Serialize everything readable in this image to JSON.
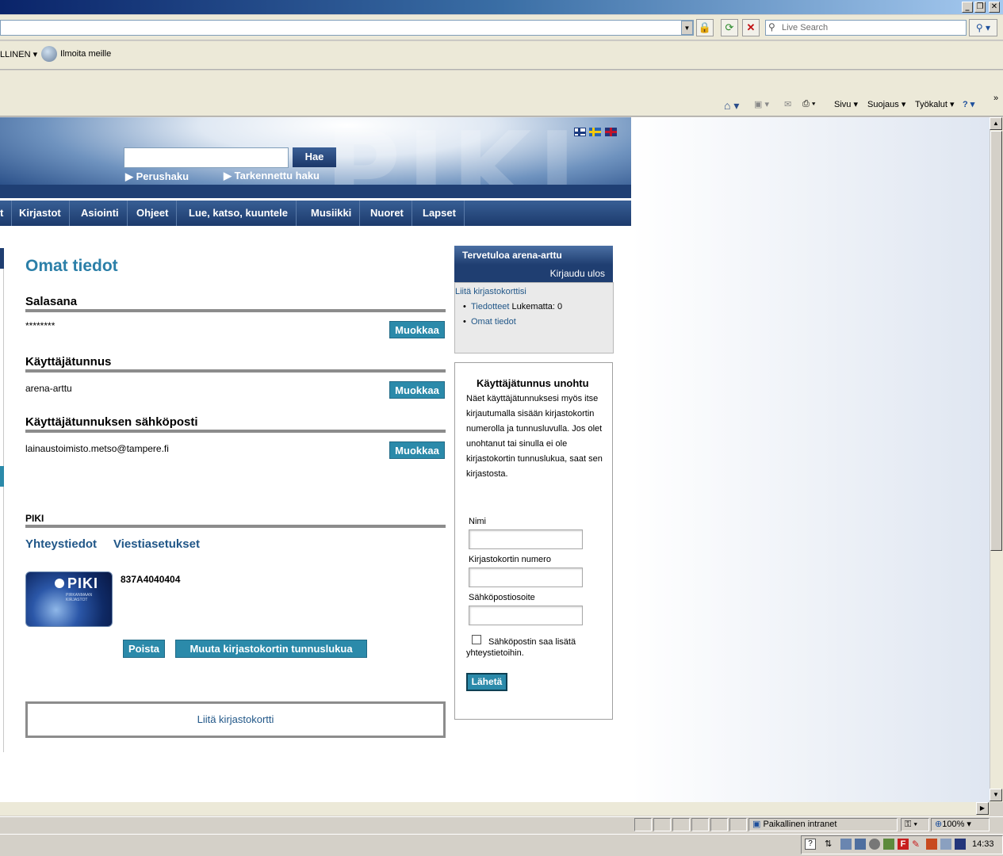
{
  "browser": {
    "live_search_placeholder": "Live Search",
    "links_item": "LLINEN",
    "links_report": "Ilmoita meille",
    "cmd_page": "Sivu",
    "cmd_safety": "Suojaus",
    "cmd_tools": "Työkalut",
    "status_zone": "Paikallinen intranet",
    "zoom": "100%",
    "clock": "14:33"
  },
  "header": {
    "search_button": "Hae",
    "basic_search": "Perushaku",
    "advanced_search": "Tarkennettu haku",
    "banner_logo": "PIKI"
  },
  "nav": {
    "items": [
      "t",
      "Kirjastot",
      "Asiointi",
      "Ohjeet",
      "Lue, katso, kuuntele",
      "Musiikki",
      "Nuoret",
      "Lapset"
    ]
  },
  "main": {
    "title": "Omat tiedot",
    "password_heading": "Salasana",
    "password_value": "********",
    "username_heading": "Käyttäjätunnus",
    "username_value": "arena-arttu",
    "email_heading": "Käyttäjätunnuksen sähköposti",
    "email_value": "lainaustoimisto.metso@tampere.fi",
    "edit_label": "Muokkaa",
    "piki_heading": "PIKI",
    "tab_contact": "Yhteystiedot",
    "tab_messages": "Viestiasetukset",
    "card_number": "837A4040404",
    "card_logo": "PIKI",
    "card_subtitle": "PIRKANMAAN KIRJASTOT",
    "remove_button": "Poista",
    "change_pin_button": "Muuta kirjastokortin tunnuslukua",
    "attach_card": "Liitä kirjastokortti"
  },
  "sidebar": {
    "welcome": "Tervetuloa arena-arttu",
    "logout": "Kirjaudu ulos",
    "attach_card_link": "Liitä kirjastokorttisi",
    "bulletins_link": "Tiedotteet",
    "bulletins_unread": "Lukematta: 0",
    "my_info_link": "Omat tiedot",
    "forgot_title": "Käyttäjätunnus unohtu",
    "forgot_text": "Näet käyttäjätunnuksesi myös itse kirjautumalla sisään kirjastokortin numerolla ja tunnusluvulla. Jos olet unohtanut tai sinulla ei ole kirjastokortin tunnuslukua, saat sen kirjastosta.",
    "name_label": "Nimi",
    "card_number_label": "Kirjastokortin numero",
    "email_label": "Sähköpostiosoite",
    "consent_label": "Sähköpostin saa lisätä yhteystietoihin.",
    "send_button": "Lähetä"
  }
}
